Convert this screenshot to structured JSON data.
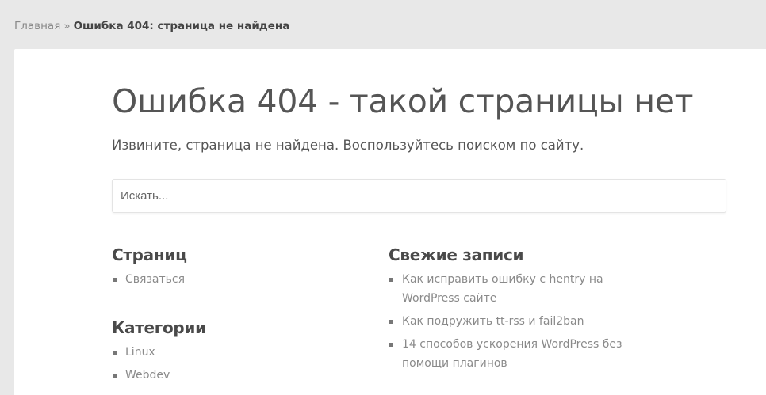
{
  "breadcrumb": {
    "home": "Главная",
    "separator": "»",
    "current": "Ошибка 404: страница не найдена"
  },
  "main": {
    "title": "Ошибка 404 - такой страницы нет",
    "intro": "Извините, страница не найдена. Воспользуйтесь поиском по сайту.",
    "search": {
      "placeholder": "Искать...",
      "value": ""
    }
  },
  "widgets": {
    "pages": {
      "title": "Страниц",
      "items": [
        {
          "label": "Связаться"
        }
      ]
    },
    "categories": {
      "title": "Категории",
      "items": [
        {
          "label": "Linux"
        },
        {
          "label": "Webdev"
        }
      ]
    },
    "recent": {
      "title": "Свежие записи",
      "items": [
        {
          "label": "Как исправить ошибку с hentry на WordPress сайте"
        },
        {
          "label": "Как подружить tt-rss и fail2ban"
        },
        {
          "label": "14 способов ускорения WordPress без помощи плагинов"
        }
      ]
    }
  },
  "colors": {
    "background": "#e8e8e8",
    "card": "#ffffff",
    "text": "#555555",
    "link": "#8a8a8a",
    "bullet": "#777777"
  }
}
